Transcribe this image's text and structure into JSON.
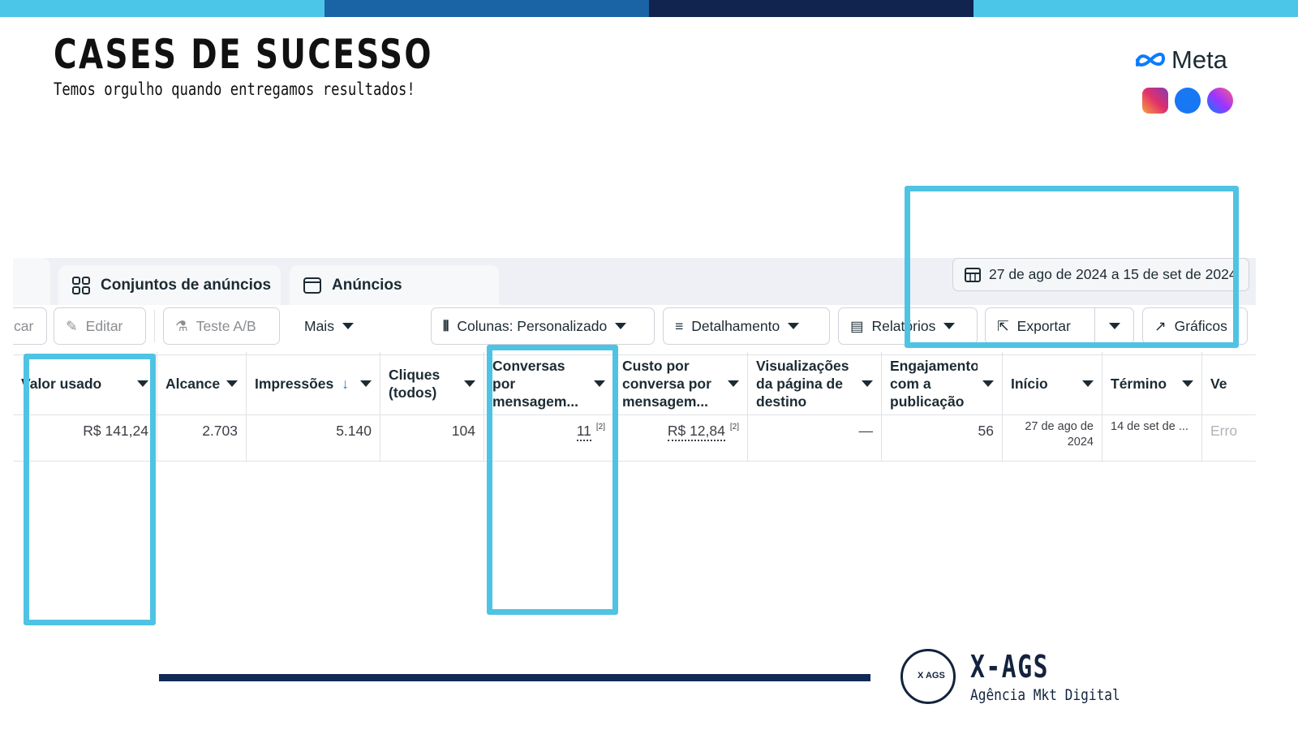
{
  "colors": {
    "bar_1": "#4cc6e8",
    "bar_2": "#1a63a5",
    "bar_3": "#11244f",
    "bar_4": "#4cc6e8",
    "highlight": "#4fc3e3",
    "navy": "#102a56"
  },
  "header": {
    "title": "CASES DE SUCESSO",
    "subtitle": "Temos orgulho quando entregamos resultados!"
  },
  "meta": {
    "word": "Meta",
    "icons": [
      "instagram-icon",
      "facebook-icon",
      "messenger-icon"
    ]
  },
  "tabs": {
    "ad_sets": "Conjuntos de anúncios",
    "ads": "Anúncios"
  },
  "date_range": "27 de ago de 2024 a 15 de set de 2024",
  "toolbar": {
    "partial_left": "car",
    "edit": "Editar",
    "ab_test": "Teste A/B",
    "more": "Mais",
    "columns": "Colunas: Personalizado",
    "breakdown": "Detalhamento",
    "reports": "Relatórios",
    "export": "Exportar",
    "charts": "Gráficos"
  },
  "table": {
    "headers": {
      "amount_spent": "Valor usado",
      "reach": "Alcance",
      "impressions": "Impressões",
      "clicks": "Cliques (todos)",
      "conversations": "Conversas por mensagem...",
      "cost_per_conversation": "Custo por conversa por mensagem...",
      "landing_views": "Visualizações da página de destino",
      "engagement": "Engajamento com a publicação",
      "start": "Início",
      "end": "Término",
      "partial": "Ve"
    },
    "row": {
      "amount_spent": "R$ 141,24",
      "reach": "2.703",
      "impressions": "5.140",
      "clicks": "104",
      "conversations": "11",
      "conversations_note": "[2]",
      "cost_per_conversation": "R$ 12,84",
      "cost_note": "[2]",
      "landing_views": "—",
      "engagement": "56",
      "start": "27 de ago de 2024",
      "end": "14 de set de ...",
      "partial": "Erro"
    }
  },
  "brand": {
    "mark": "X AGS",
    "name": "X-AGS",
    "tagline": "Agência Mkt Digital"
  }
}
